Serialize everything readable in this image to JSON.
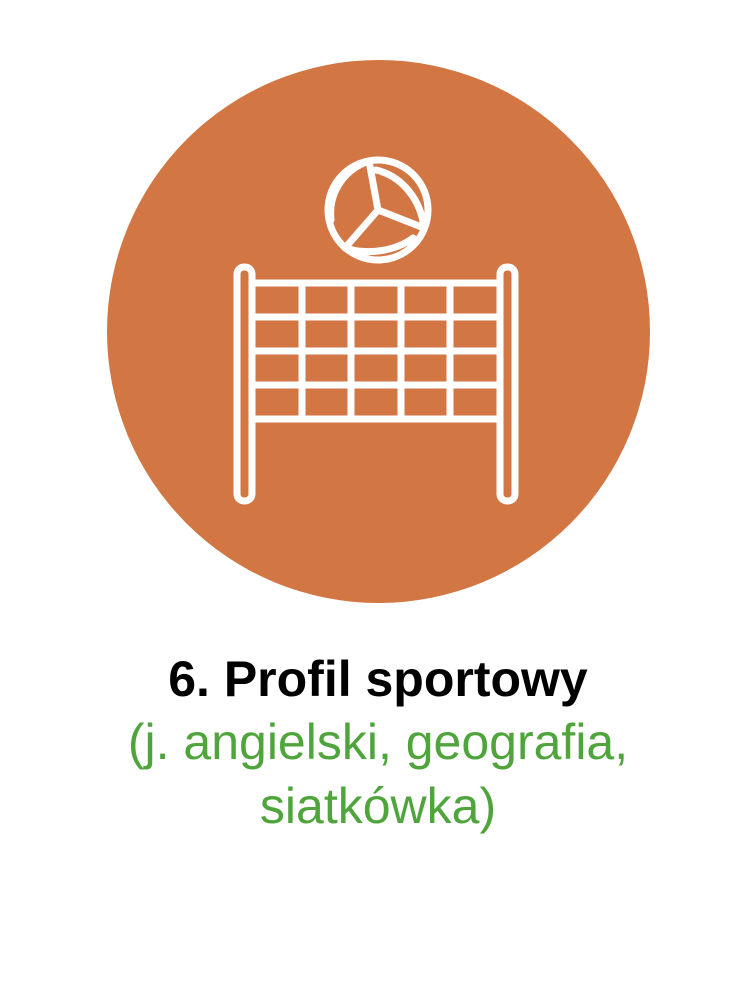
{
  "icon": {
    "name": "volleyball-net-icon",
    "circle_color": "#D27744",
    "line_color": "#FFFFFF"
  },
  "caption": {
    "title": "6. Profil sportowy",
    "subtitle_line1": "(j. angielski, geografia,",
    "subtitle_line2": "siatkówka)",
    "title_color": "#000000",
    "subtitle_color": "#4FA53C"
  }
}
